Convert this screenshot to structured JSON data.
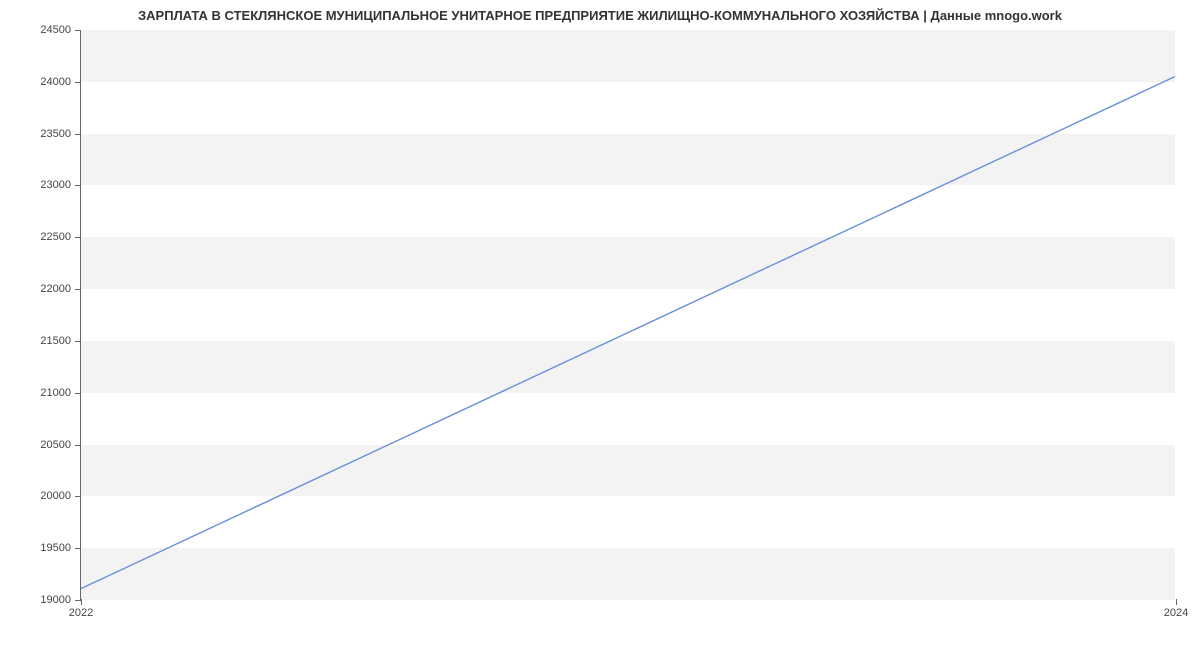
{
  "chart_data": {
    "type": "line",
    "title": "ЗАРПЛАТА В СТЕКЛЯНСКОЕ МУНИЦИПАЛЬНОЕ УНИТАРНОЕ ПРЕДПРИЯТИЕ ЖИЛИЩНО-КОММУНАЛЬНОГО ХОЗЯЙСТВА | Данные mnogo.work",
    "x": [
      2022,
      2024
    ],
    "values": [
      19100,
      24050
    ],
    "xlabel": "",
    "ylabel": "",
    "xlim": [
      2022,
      2024
    ],
    "ylim": [
      19000,
      24500
    ],
    "y_ticks": [
      19000,
      19500,
      20000,
      20500,
      21000,
      21500,
      22000,
      22500,
      23000,
      23500,
      24000,
      24500
    ],
    "x_ticks": [
      2022,
      2024
    ],
    "grid": true,
    "line_color": "#6a8fd8",
    "band_color": "#f3f3f3"
  }
}
